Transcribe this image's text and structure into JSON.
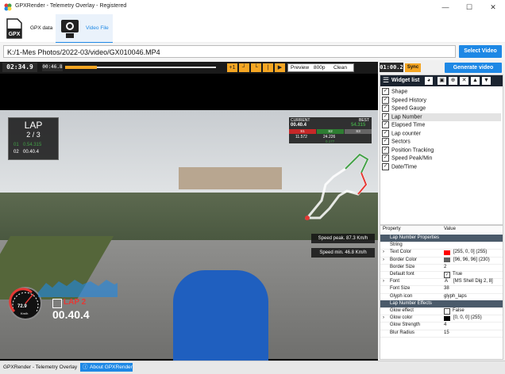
{
  "window": {
    "title": "GPXRender - Telemetry Overlay - Registered",
    "controls": [
      "—",
      "☐",
      "✕"
    ]
  },
  "mode_tabs": [
    {
      "label": "GPX data",
      "icon": "gpx-file-icon"
    },
    {
      "label": "Video File",
      "icon": "camera-icon"
    }
  ],
  "path_bar": {
    "value": "K:/1-Mes Photos/2022-03/video/GX010046.MP4",
    "select_button": "Select Video"
  },
  "playbar": {
    "current_time": "02:34.9",
    "start_time": "00:46.8",
    "sync_time": "01:00.2",
    "sync_label": "Sync",
    "preview_label": "Preview",
    "resolution": "800p",
    "quality": "Clean",
    "generate_button": "Generate video",
    "plus_label": "+1"
  },
  "overlay": {
    "lap_title": "LAP",
    "lap_value": "2 / 3",
    "lap_row1_num": "01",
    "lap_row1_time": "0.54.315",
    "lap_row2_num": "02",
    "lap_row2_time": "00.40.4",
    "current_label": "CURRENT",
    "current_time": "00.40.4",
    "best_label": "BEST",
    "best_time": "54.315",
    "sectors": [
      "S1",
      "S2",
      "S3"
    ],
    "sector_times": [
      "11.572",
      "24.226",
      "..."
    ],
    "sector_delta": "0.177",
    "speed_peak": "Speed peak. 87.3 Km/h",
    "speed_min": "Speed min. 46.8 Km/h",
    "gauge_value": "72.9",
    "gauge_unit": "Km/h",
    "lap_badge": "LAP 2",
    "lap_time_big": "00.40.4"
  },
  "widget_list": {
    "title": "Widget list",
    "items": [
      {
        "label": "Shape",
        "checked": true,
        "selected": false
      },
      {
        "label": "Speed History",
        "checked": true,
        "selected": false
      },
      {
        "label": "Speed Gauge",
        "checked": true,
        "selected": false
      },
      {
        "label": "Lap Number",
        "checked": true,
        "selected": true
      },
      {
        "label": "Elapsed Time",
        "checked": true,
        "selected": false
      },
      {
        "label": "Lap counter",
        "checked": true,
        "selected": false
      },
      {
        "label": "Sectors",
        "checked": true,
        "selected": false
      },
      {
        "label": "Position Tracking",
        "checked": true,
        "selected": false
      },
      {
        "label": "Speed Peak/Min",
        "checked": true,
        "selected": false
      },
      {
        "label": "Date/Time",
        "checked": true,
        "selected": false
      }
    ]
  },
  "properties": {
    "col_property": "Property",
    "col_value": "Value",
    "rows": [
      {
        "type": "section",
        "name": "Lap Number Properties"
      },
      {
        "type": "row",
        "name": "String",
        "value": ""
      },
      {
        "type": "row",
        "name": "Text Color",
        "value": "[255, 0, 0] (255)",
        "swatch": "#ff0000",
        "expand": true
      },
      {
        "type": "row",
        "name": "Border Color",
        "value": "[96, 96, 96] (230)",
        "swatch": "#606060",
        "expand": true
      },
      {
        "type": "row",
        "name": "Border Size",
        "value": "2"
      },
      {
        "type": "row",
        "name": "Default font",
        "value": "True",
        "check": true
      },
      {
        "type": "row",
        "name": "Font",
        "value": "[MS Shell Dlg 2, 8]",
        "expand": true,
        "fonticon": "A"
      },
      {
        "type": "row",
        "name": "Font Size",
        "value": "38"
      },
      {
        "type": "row",
        "name": "Glyph icon",
        "value": "glyph_laps"
      },
      {
        "type": "section",
        "name": "Lap Number Effects"
      },
      {
        "type": "row",
        "name": "Glow effect",
        "value": "False",
        "check": false
      },
      {
        "type": "row",
        "name": "Glow color",
        "value": "[0, 0, 0] (255)",
        "swatch": "#000000",
        "expand": true
      },
      {
        "type": "row",
        "name": "Glow Strength",
        "value": "4"
      },
      {
        "type": "row",
        "name": "Blur Radius",
        "value": "15"
      }
    ]
  },
  "statusbar": {
    "left": "GPXRender - Telemetry Overlay",
    "about": "About GPXRender"
  },
  "colors": {
    "accent": "#1e88e5",
    "orange": "#f5a623",
    "lap_red": "#e53935"
  }
}
